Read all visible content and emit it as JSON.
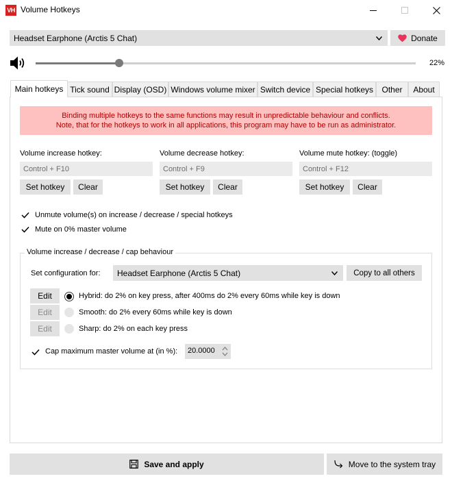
{
  "window": {
    "icon_text": "VH",
    "title": "Volume Hotkeys"
  },
  "device_select": {
    "value": "Headset Earphone (Arctis 5 Chat)"
  },
  "donate_button": {
    "label": "Donate",
    "heart_color": "#e8345a"
  },
  "volume": {
    "level": 0.22,
    "percent_text": "22%"
  },
  "tabs": [
    {
      "label": "Main hotkeys",
      "active": true
    },
    {
      "label": "Tick sound"
    },
    {
      "label": "Display (OSD)"
    },
    {
      "label": "Windows volume mixer"
    },
    {
      "label": "Switch device"
    },
    {
      "label": "Special hotkeys"
    },
    {
      "label": "Other"
    },
    {
      "label": "About"
    }
  ],
  "warning": {
    "line1": "Binding multiple hotkeys to the same functions may result in unpredictable behaviour and conflicts.",
    "line2": "Note, that for the hotkeys to work in all applications, this program may have to be run as administrator."
  },
  "hotkeys": [
    {
      "label": "Volume increase hotkey:",
      "value": "Control + F10",
      "set_label": "Set hotkey",
      "clear_label": "Clear"
    },
    {
      "label": "Volume decrease hotkey:",
      "value": "Control + F9",
      "set_label": "Set hotkey",
      "clear_label": "Clear"
    },
    {
      "label": "Volume mute hotkey: (toggle)",
      "value": "Control + F12",
      "set_label": "Set hotkey",
      "clear_label": "Clear"
    }
  ],
  "options": {
    "unmute_label": "Unmute volume(s) on increase / decrease / special hotkeys",
    "unmute_checked": true,
    "mute_zero_label": "Mute on 0% master volume",
    "mute_zero_checked": true
  },
  "behaviour": {
    "group_title": "Volume increase / decrease / cap behaviour",
    "config_label": "Set configuration for:",
    "config_value": "Headset Earphone (Arctis 5 Chat)",
    "copy_label": "Copy to all others",
    "modes": [
      {
        "edit_label": "Edit",
        "text": "Hybrid: do 2% on key press, after 400ms do 2% every 60ms while key is down",
        "selected": true
      },
      {
        "edit_label": "Edit",
        "text": "Smooth: do 2% every 60ms while key is down",
        "selected": false
      },
      {
        "edit_label": "Edit",
        "text": "Sharp: do 2% on each key press",
        "selected": false
      }
    ],
    "cap_label": "Cap maximum master volume at (in %):",
    "cap_checked": true,
    "cap_value": "20.0000"
  },
  "footer": {
    "save_label": "Save and apply",
    "tray_label": "Move to the system tray"
  }
}
